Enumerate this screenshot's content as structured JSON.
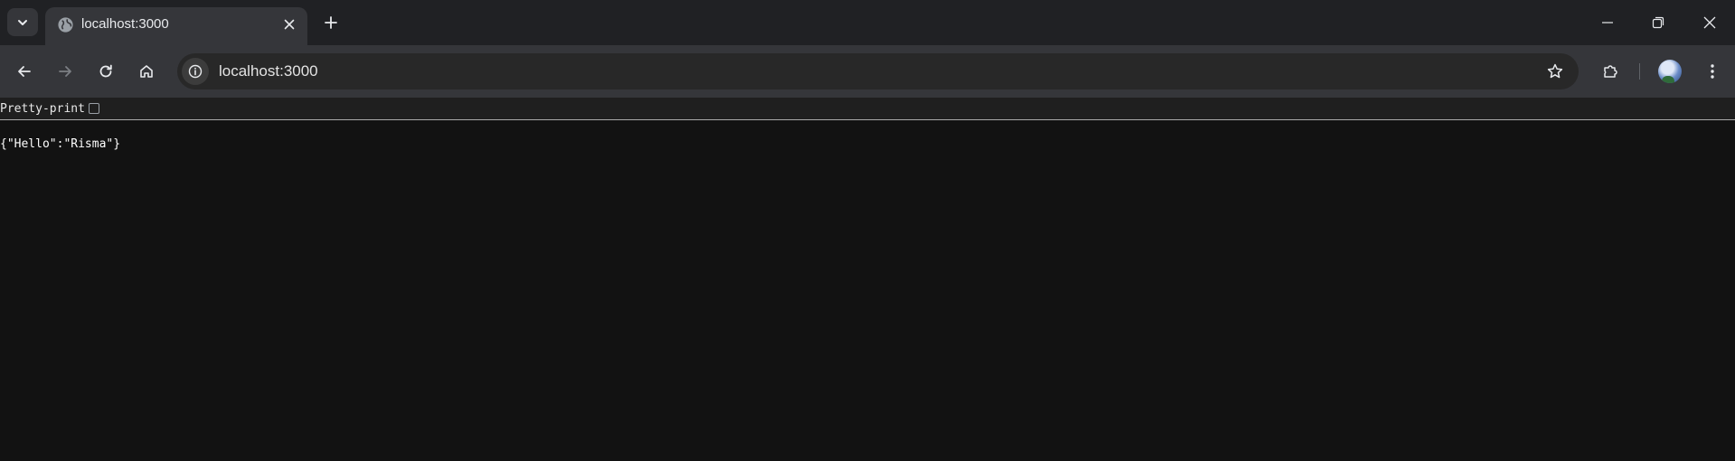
{
  "browser": {
    "tab": {
      "title": "localhost:3000",
      "favicon": "globe-icon"
    },
    "toolbar": {
      "url": "localhost:3000"
    },
    "icons": {
      "tab_search": "chevron-down-icon",
      "close_tab": "close-icon",
      "new_tab": "plus-icon",
      "minimize": "minimize-icon",
      "restore": "restore-icon",
      "close_window": "close-icon",
      "back": "back-arrow-icon",
      "forward": "forward-arrow-icon",
      "reload": "reload-icon",
      "home": "home-icon",
      "site_info": "info-icon",
      "bookmark": "star-icon",
      "extensions": "puzzle-icon",
      "menu": "kebab-menu-icon"
    }
  },
  "page": {
    "pretty_print_label": "Pretty-print",
    "pretty_print_checked": false,
    "json_text": "{\"Hello\":\"Risma\"}"
  },
  "colors": {
    "tabstrip_bg": "#202124",
    "toolbar_bg": "#35363a",
    "page_bg": "#121212"
  }
}
